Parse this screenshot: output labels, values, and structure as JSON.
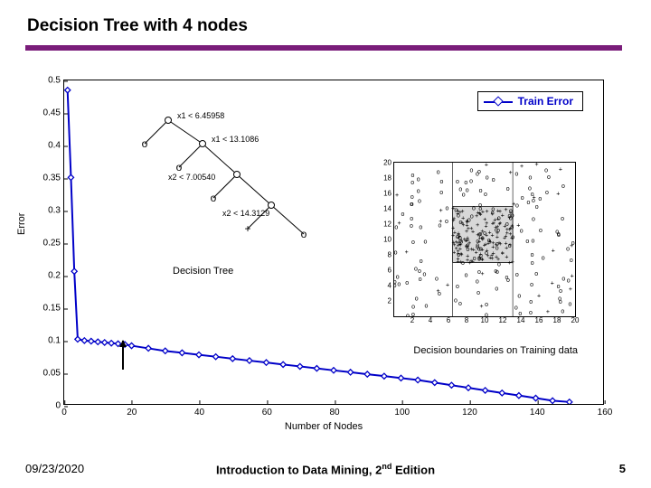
{
  "slide": {
    "title": "Decision Tree with 4 nodes",
    "date": "09/23/2020",
    "book": "Introduction to Data Mining, 2",
    "edition_sup": "nd",
    "edition_tail": " Edition",
    "page": "5"
  },
  "chart_data": {
    "type": "line",
    "title": "",
    "xlabel": "Number of Nodes",
    "ylabel": "Error",
    "xlim": [
      0,
      160
    ],
    "ylim": [
      0,
      0.5
    ],
    "xticks": [
      0,
      20,
      40,
      60,
      80,
      100,
      120,
      140,
      160
    ],
    "yticks": [
      0,
      0.05,
      0.1,
      0.15,
      0.2,
      0.25,
      0.3,
      0.35,
      0.4,
      0.45,
      0.5
    ],
    "legend": "Train Error",
    "series": [
      {
        "name": "Train Error",
        "x": [
          1,
          2,
          3,
          4,
          6,
          8,
          10,
          12,
          14,
          16,
          18,
          20,
          25,
          30,
          35,
          40,
          45,
          50,
          55,
          60,
          65,
          70,
          75,
          80,
          85,
          90,
          95,
          100,
          105,
          110,
          115,
          120,
          125,
          130,
          135,
          140,
          145,
          150
        ],
        "y": [
          0.485,
          0.35,
          0.205,
          0.1,
          0.098,
          0.097,
          0.096,
          0.095,
          0.094,
          0.093,
          0.092,
          0.09,
          0.086,
          0.082,
          0.079,
          0.076,
          0.073,
          0.07,
          0.067,
          0.064,
          0.061,
          0.058,
          0.055,
          0.052,
          0.049,
          0.046,
          0.043,
          0.04,
          0.037,
          0.033,
          0.029,
          0.025,
          0.021,
          0.017,
          0.013,
          0.009,
          0.005,
          0.003
        ]
      }
    ],
    "annotations": {
      "tree_caption": "Decision Tree",
      "scatter_caption": "Decision boundaries on Training data",
      "tree_splits": [
        "x1 < 6.45958",
        "x1 < 13.1086",
        "x2 < 7.00540",
        "x2 < 14.3129"
      ],
      "scatter_axis_ticks": {
        "x": [
          2,
          4,
          6,
          8,
          10,
          12,
          14,
          16,
          18,
          20
        ],
        "y": [
          2,
          4,
          6,
          8,
          10,
          12,
          14,
          16,
          18,
          20
        ]
      },
      "scatter_shaded_region": {
        "x": [
          6.46,
          13.11
        ],
        "y": [
          7.01,
          14.31
        ]
      }
    }
  }
}
